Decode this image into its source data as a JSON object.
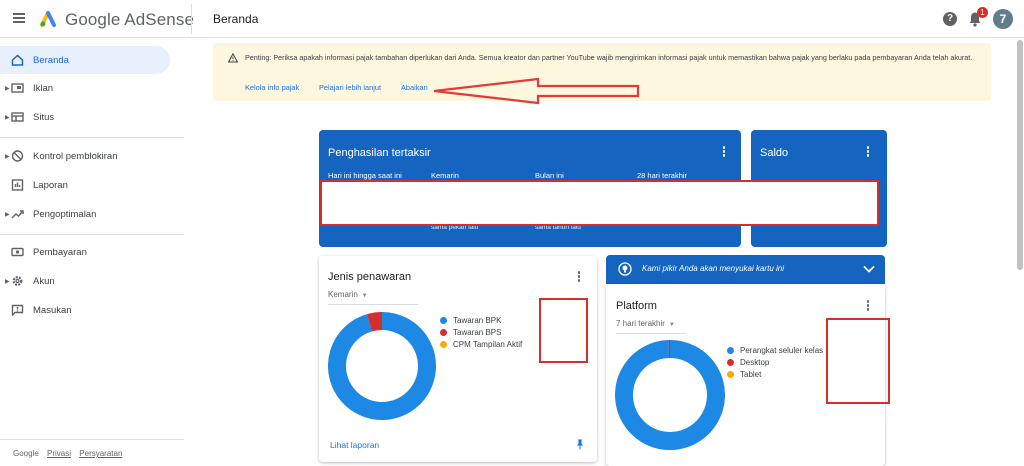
{
  "header": {
    "brand": "Google AdSense",
    "page_title": "Beranda",
    "notification_count": "1",
    "avatar_initial": "7"
  },
  "sidebar": {
    "items": [
      {
        "label": "Beranda",
        "icon": "home-icon",
        "active": true
      },
      {
        "label": "Iklan",
        "icon": "ads-icon"
      },
      {
        "label": "Situs",
        "icon": "sites-icon"
      },
      {
        "label": "Kontrol pemblokiran",
        "icon": "block-icon"
      },
      {
        "label": "Laporan",
        "icon": "reports-icon"
      },
      {
        "label": "Pengoptimalan",
        "icon": "trend-icon"
      },
      {
        "label": "Pembayaran",
        "icon": "payments-icon"
      },
      {
        "label": "Akun",
        "icon": "gear-icon"
      },
      {
        "label": "Masukan",
        "icon": "feedback-icon"
      }
    ],
    "footer": {
      "google": "Google",
      "privacy": "Privasi",
      "terms": "Persyaratan"
    }
  },
  "banner": {
    "text": "Penting: Periksa apakah informasi pajak tambahan diperlukan dari Anda. Semua kreator dan partner YouTube wajib mengirimkan informasi pajak untuk memastikan bahwa pajak yang berlaku pada pembayaran Anda telah akurat.",
    "links": [
      "Kelola info pajak",
      "Pelajari lebih lanjut",
      "Abaikan"
    ]
  },
  "earnings": {
    "title": "Penghasilan tertaksir",
    "columns": [
      "Hari ini hingga saat ini",
      "Kemarin",
      "Bulan ini",
      "28 hari terakhir"
    ],
    "subs": [
      "sama pekan lalu",
      "sama tahun lalu"
    ]
  },
  "balance": {
    "title": "Saldo"
  },
  "offer_card": {
    "title": "Jenis penawaran",
    "period": "Kemarin",
    "legend": [
      {
        "label": "Tawaran BPK",
        "color": "#1e88e5"
      },
      {
        "label": "Tawaran BPS",
        "color": "#d32f2f"
      },
      {
        "label": "CPM Tampilan Aktif",
        "color": "#f9ab00"
      }
    ],
    "link": "Lihat laporan"
  },
  "info_bar": {
    "text": "Kami pikir Anda akan menyukai kartu ini"
  },
  "platform_card": {
    "title": "Platform",
    "period": "7 hari terakhir",
    "legend": [
      {
        "label": "Perangkat seluler kelas",
        "color": "#1e88e5"
      },
      {
        "label": "Desktop",
        "color": "#d32f2f"
      },
      {
        "label": "Tablet",
        "color": "#f9ab00"
      }
    ]
  },
  "chart_data": [
    {
      "type": "pie",
      "title": "Jenis penawaran",
      "categories": [
        "Tawaran BPK",
        "Tawaran BPS",
        "CPM Tampilan Aktif"
      ],
      "values": [
        95.5,
        4.5,
        0
      ]
    },
    {
      "type": "pie",
      "title": "Platform",
      "categories": [
        "Perangkat seluler kelas",
        "Desktop",
        "Tablet"
      ],
      "values": [
        99.6,
        0.4,
        0
      ]
    }
  ]
}
